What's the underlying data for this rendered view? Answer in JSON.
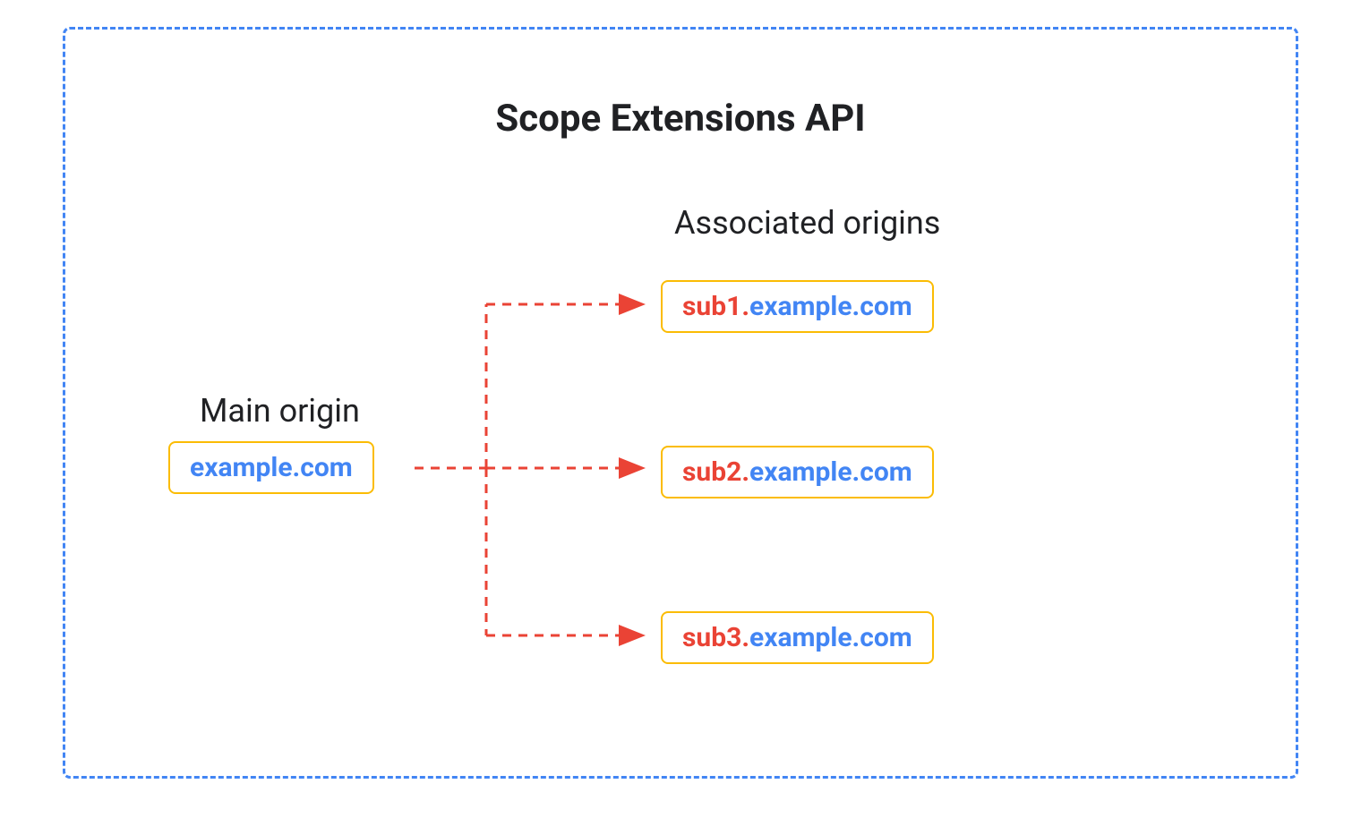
{
  "title": "Scope Extensions API",
  "mainOriginLabel": "Main origin",
  "associatedOriginsLabel": "Associated origins",
  "mainOrigin": {
    "domain": "example.com"
  },
  "associatedOrigins": [
    {
      "prefix": "sub1",
      "domain": "example.com"
    },
    {
      "prefix": "sub2",
      "domain": "example.com"
    },
    {
      "prefix": "sub3",
      "domain": "example.com"
    }
  ],
  "colors": {
    "borderBlue": "#4285f4",
    "boxBorder": "#fbbc04",
    "domainBlue": "#4285f4",
    "subRed": "#ea4335",
    "arrowRed": "#ea4335"
  }
}
